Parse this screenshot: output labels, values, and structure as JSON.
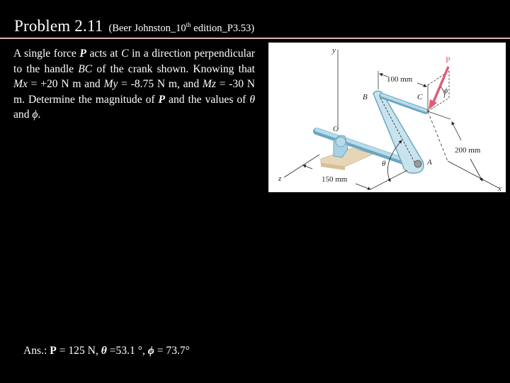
{
  "header": {
    "title": "Problem 2.11",
    "subtitle_prefix": "(Beer Johnston_10",
    "subtitle_sup": "th",
    "subtitle_suffix": " edition_P3.53)"
  },
  "problem": {
    "segments": [
      {
        "t": "A single force ",
        "s": "normal"
      },
      {
        "t": "P",
        "s": "bold-italic"
      },
      {
        "t": " acts at ",
        "s": "normal"
      },
      {
        "t": "C",
        "s": "italic"
      },
      {
        "t": " in a direction perpendicular to the handle ",
        "s": "normal"
      },
      {
        "t": "BC",
        "s": "italic"
      },
      {
        "t": " of the crank shown. Knowing that ",
        "s": "normal"
      },
      {
        "t": "Mx",
        "s": "italic"
      },
      {
        "t": " = +20 N m and ",
        "s": "normal"
      },
      {
        "t": "My",
        "s": "italic"
      },
      {
        "t": " = -8.75 N m, and ",
        "s": "normal"
      },
      {
        "t": "Mz",
        "s": "italic"
      },
      {
        "t": " = -30 N m. Determine the magnitude of ",
        "s": "normal"
      },
      {
        "t": "P",
        "s": "bold-italic"
      },
      {
        "t": " and the values of ",
        "s": "normal"
      },
      {
        "t": "θ",
        "s": "italic"
      },
      {
        "t": " and ",
        "s": "normal"
      },
      {
        "t": "ϕ",
        "s": "italic"
      },
      {
        "t": ".",
        "s": "normal"
      }
    ]
  },
  "figure": {
    "labels": {
      "y_axis": "y",
      "x_axis": "x",
      "z_axis": "z",
      "origin": "O",
      "point_a": "A",
      "point_b": "B",
      "point_c": "C",
      "force": "P",
      "theta": "θ",
      "phi": "ϕ",
      "dim_bc": "100 mm",
      "dim_ab": "200 mm",
      "dim_oa": "150 mm"
    },
    "colors": {
      "force_arrow": "#e05a78",
      "crank_fill": "#b9dbe9",
      "crank_stroke": "#6aa7c2",
      "base_fill": "#e6d6b6"
    }
  },
  "answer": {
    "prefix": "Ans.: ",
    "p_label": "P",
    "p_value": " = 125 N, ",
    "theta_label": "θ",
    "theta_value": " =53.1 °, ",
    "phi_label": "ϕ",
    "phi_value": " = 73.7°"
  }
}
